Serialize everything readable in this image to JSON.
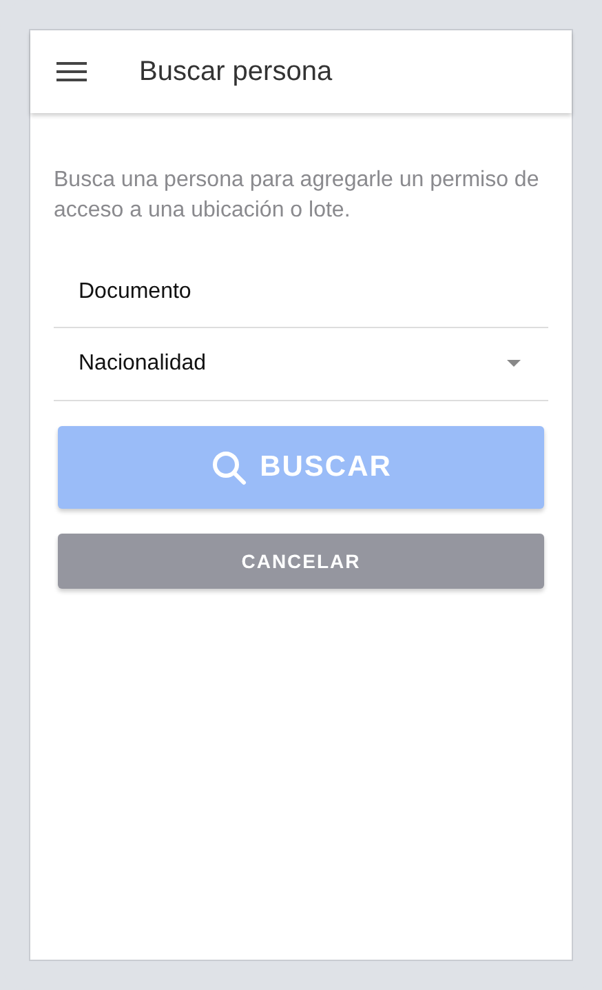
{
  "app_bar": {
    "title": "Buscar persona"
  },
  "description": "Busca una persona para agregarle un permiso de acceso a una ubicación o lote.",
  "fields": [
    {
      "kind": "text",
      "placeholder": "Documento"
    },
    {
      "kind": "select",
      "placeholder": "Nacionalidad"
    }
  ],
  "buttons": [
    {
      "kind": "primary",
      "label": "BUSCAR",
      "disabled": true
    },
    {
      "kind": "secondary",
      "label": "CANCELAR",
      "disabled": false
    }
  ]
}
